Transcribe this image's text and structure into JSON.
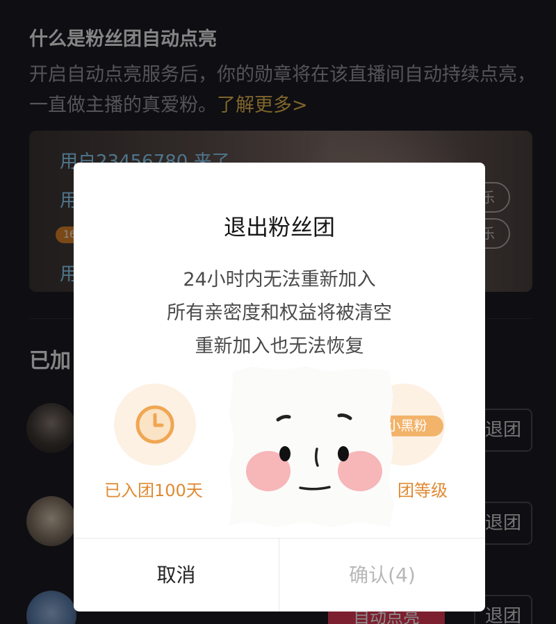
{
  "background": {
    "section_title": "什么是粉丝团自动点亮",
    "section_desc": "开启自动点亮服务后，你的勋章将在该直播间自动持续点亮，一直做主播的真爱粉。",
    "learn_more": "了解更多>",
    "preview": {
      "lines": [
        "用户23456780 来了",
        "用",
        "用"
      ],
      "badge": "16",
      "pills": [
        "乐",
        "乐"
      ]
    },
    "joined_title": "已加",
    "rows": [
      {
        "quit_label": "退团"
      },
      {
        "quit_label": "退团"
      },
      {
        "auto_label": "自动点亮",
        "quit_label": "退团"
      }
    ]
  },
  "dialog": {
    "title": "退出粉丝团",
    "lines": [
      "24小时内无法重新加入",
      "所有亲密度和权益将被清空",
      "重新加入也无法恢复"
    ],
    "features": [
      {
        "icon": "clock-icon",
        "label": "已入团100天"
      },
      {
        "badge": "小黑粉",
        "label": "团等级"
      }
    ],
    "sticker": "smiley-sticker",
    "cancel_label": "取消",
    "confirm_label": "确认(4)"
  },
  "colors": {
    "accent_orange": "#df8a33",
    "learn_more": "#e9b94d",
    "danger": "#e23a55",
    "confirm_disabled": "#b7b7b7"
  }
}
